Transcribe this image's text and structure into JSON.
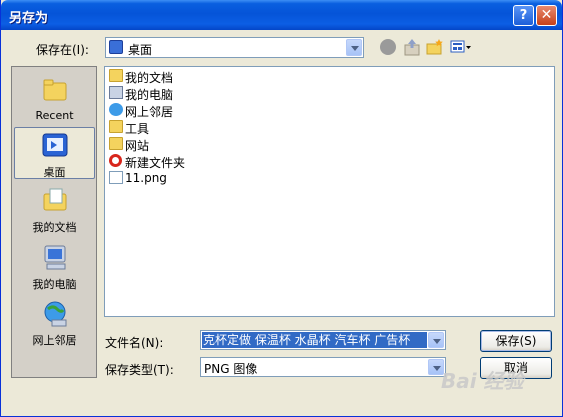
{
  "window": {
    "title": "另存为"
  },
  "title_buttons": {
    "help": "?",
    "close": "✕"
  },
  "save_in": {
    "label": "保存在(I):",
    "value": "桌面"
  },
  "places": [
    {
      "label": "Recent",
      "icon": "recent-folder-icon"
    },
    {
      "label": "桌面",
      "icon": "desktop-icon"
    },
    {
      "label": "我的文档",
      "icon": "my-documents-icon"
    },
    {
      "label": "我的电脑",
      "icon": "my-computer-icon"
    },
    {
      "label": "网上邻居",
      "icon": "network-places-icon"
    }
  ],
  "files": [
    {
      "name": "我的文档",
      "icon": "my-documents-icon"
    },
    {
      "name": "我的电脑",
      "icon": "my-computer-icon"
    },
    {
      "name": "网上邻居",
      "icon": "network-places-icon"
    },
    {
      "name": "工具",
      "icon": "folder-icon"
    },
    {
      "name": "网站",
      "icon": "folder-icon"
    },
    {
      "name": "新建文件夹",
      "icon": "opera-icon"
    },
    {
      "name": "11.png",
      "icon": "png-file-icon"
    }
  ],
  "filename": {
    "label": "文件名(N):",
    "value": "克杯定做 保温杯 水晶杯 汽车杯 广告杯"
  },
  "filetype": {
    "label": "保存类型(T):",
    "value": "PNG 图像"
  },
  "buttons": {
    "save": "保存(S)",
    "cancel": "取消"
  },
  "watermark": "Bai 经验"
}
